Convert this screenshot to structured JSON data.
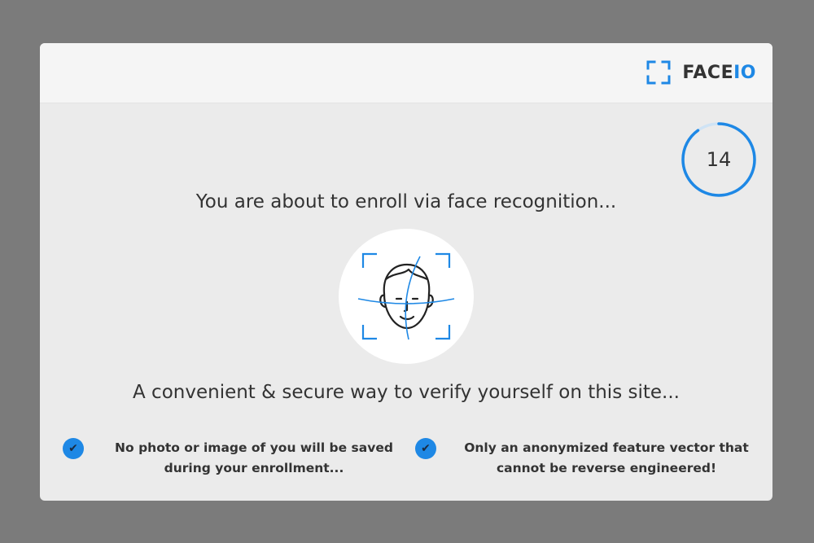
{
  "brand": {
    "name_main": "FACE",
    "name_accent": "IO",
    "icon": "face-frame-icon",
    "accent_color": "#1e88e5"
  },
  "countdown": {
    "value": "14",
    "progress": 0.9
  },
  "headline": "You are about to enroll via face recognition...",
  "illustration": {
    "icon": "face-scan-icon"
  },
  "subline": "A convenient & secure way to verify yourself on this site...",
  "features": [
    {
      "icon": "check-icon",
      "line1": "No photo or image of you will be saved",
      "line2": "during your enrollment..."
    },
    {
      "icon": "check-icon",
      "line1": "Only an anonymized feature vector that",
      "line2": "cannot be reverse engineered!"
    }
  ]
}
